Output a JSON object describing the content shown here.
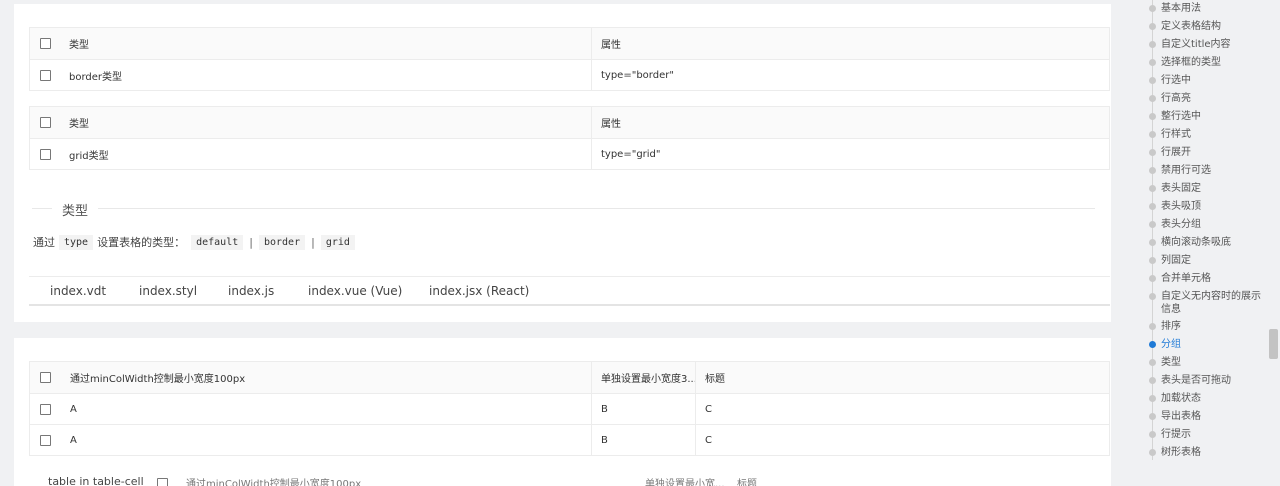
{
  "tables": {
    "border": {
      "headers": [
        "类型",
        "属性"
      ],
      "rows": [
        [
          "border类型",
          "type=\"border\""
        ]
      ]
    },
    "grid": {
      "headers": [
        "类型",
        "属性"
      ],
      "rows": [
        [
          "grid类型",
          "type=\"grid\""
        ]
      ]
    },
    "minwidth": {
      "headers": [
        "通过minColWidth控制最小宽度100px",
        "单独设置最小宽度3...",
        "标题"
      ],
      "rows": [
        [
          "A",
          "B",
          "C"
        ],
        [
          "A",
          "B",
          "C"
        ]
      ]
    }
  },
  "section": {
    "title": "类型",
    "desc_prefix": "通过",
    "desc_code": "type",
    "desc_middle": "设置表格的类型：",
    "options": [
      "default",
      "border",
      "grid"
    ],
    "separator": "|"
  },
  "code_tabs": [
    "index.vdt",
    "index.styl",
    "index.js",
    "index.vue (Vue)",
    "index.jsx (React)"
  ],
  "nested_table_partial": {
    "label": "table in table-cell",
    "col1": "通过minColWidth控制最小宽度100px",
    "col2": "单独设置最小宽...",
    "col3": "标题"
  },
  "toc": {
    "items": [
      "基本用法",
      "定义表格结构",
      "自定义title内容",
      "选择框的类型",
      "行选中",
      "行高亮",
      "整行选中",
      "行样式",
      "行展开",
      "禁用行可选",
      "表头固定",
      "表头吸顶",
      "表头分组",
      "横向滚动条吸底",
      "列固定",
      "合并单元格",
      "自定义无内容时的展示",
      "信息",
      "排序",
      "分组",
      "类型",
      "表头是否可拖动",
      "加载状态",
      "导出表格",
      "行提示",
      "树形表格"
    ],
    "active_index": 19,
    "accent_color": "#1f7ad6"
  }
}
